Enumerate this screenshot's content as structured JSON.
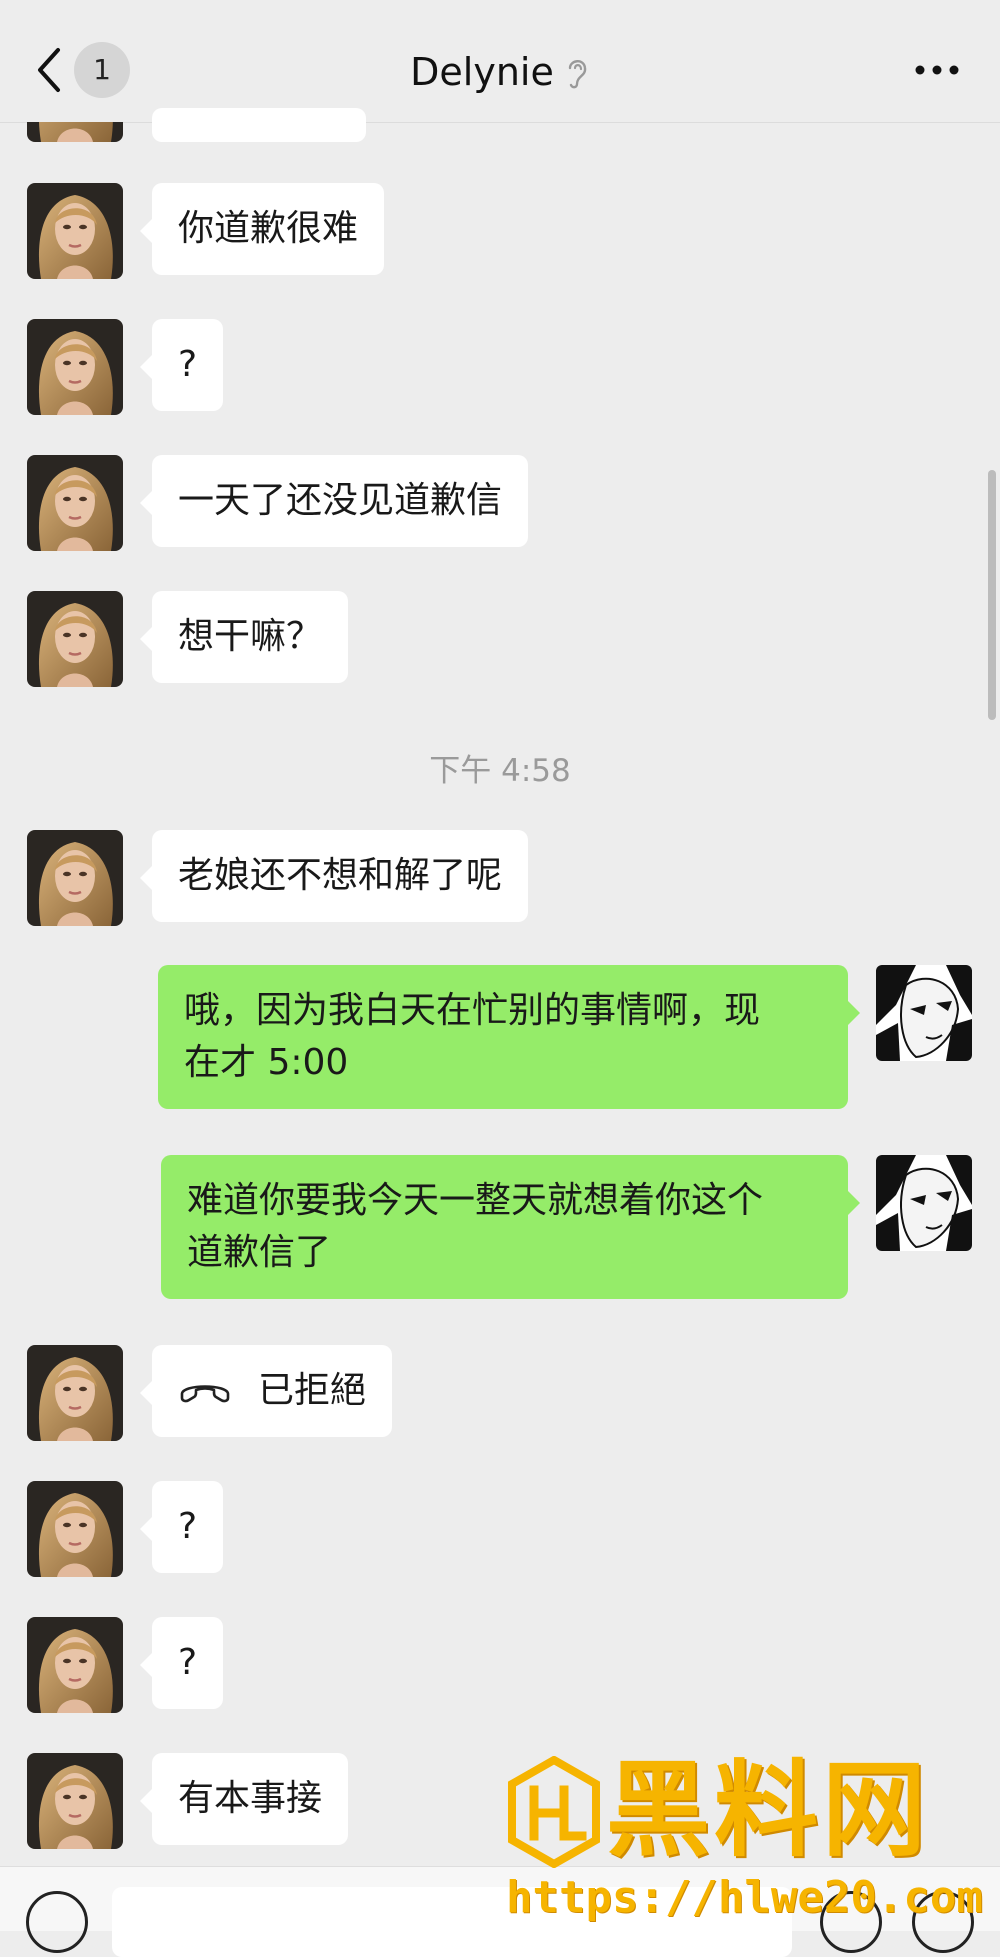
{
  "header": {
    "unread_count": "1",
    "title": "Delynie"
  },
  "messages": [
    {
      "side": "in",
      "text": "你道歉很难"
    },
    {
      "side": "in",
      "text": "?"
    },
    {
      "side": "in",
      "text": "一天了还没见道歉信"
    },
    {
      "side": "in",
      "text": "想干嘛？"
    },
    {
      "timestamp": "下午 4:58"
    },
    {
      "side": "in",
      "text": "老娘还不想和解了呢"
    },
    {
      "side": "out",
      "text": "哦，因为我白天在忙别的事情啊，现\n在才 5:00"
    },
    {
      "side": "out",
      "text": "难道你要我今天一整天就想着你这个\n道歉信了"
    },
    {
      "side": "in",
      "type": "call",
      "text": "已拒絕"
    },
    {
      "side": "in",
      "text": "?"
    },
    {
      "side": "in",
      "text": "?"
    },
    {
      "side": "in",
      "text": "有本事接"
    }
  ],
  "watermark": {
    "brand": "黑料网",
    "url": "https://hlwe20.com"
  },
  "icons": {
    "back": "chevron-left-icon",
    "ear": "ear-icon",
    "more": "more-dots-icon",
    "call": "declined-call-icon",
    "voice": "voice-icon",
    "emoji": "emoji-icon",
    "plus": "plus-icon"
  },
  "colors": {
    "background": "#ededed",
    "incoming_bubble": "#ffffff",
    "outgoing_bubble": "#95ec69",
    "watermark": "#f6b400"
  }
}
